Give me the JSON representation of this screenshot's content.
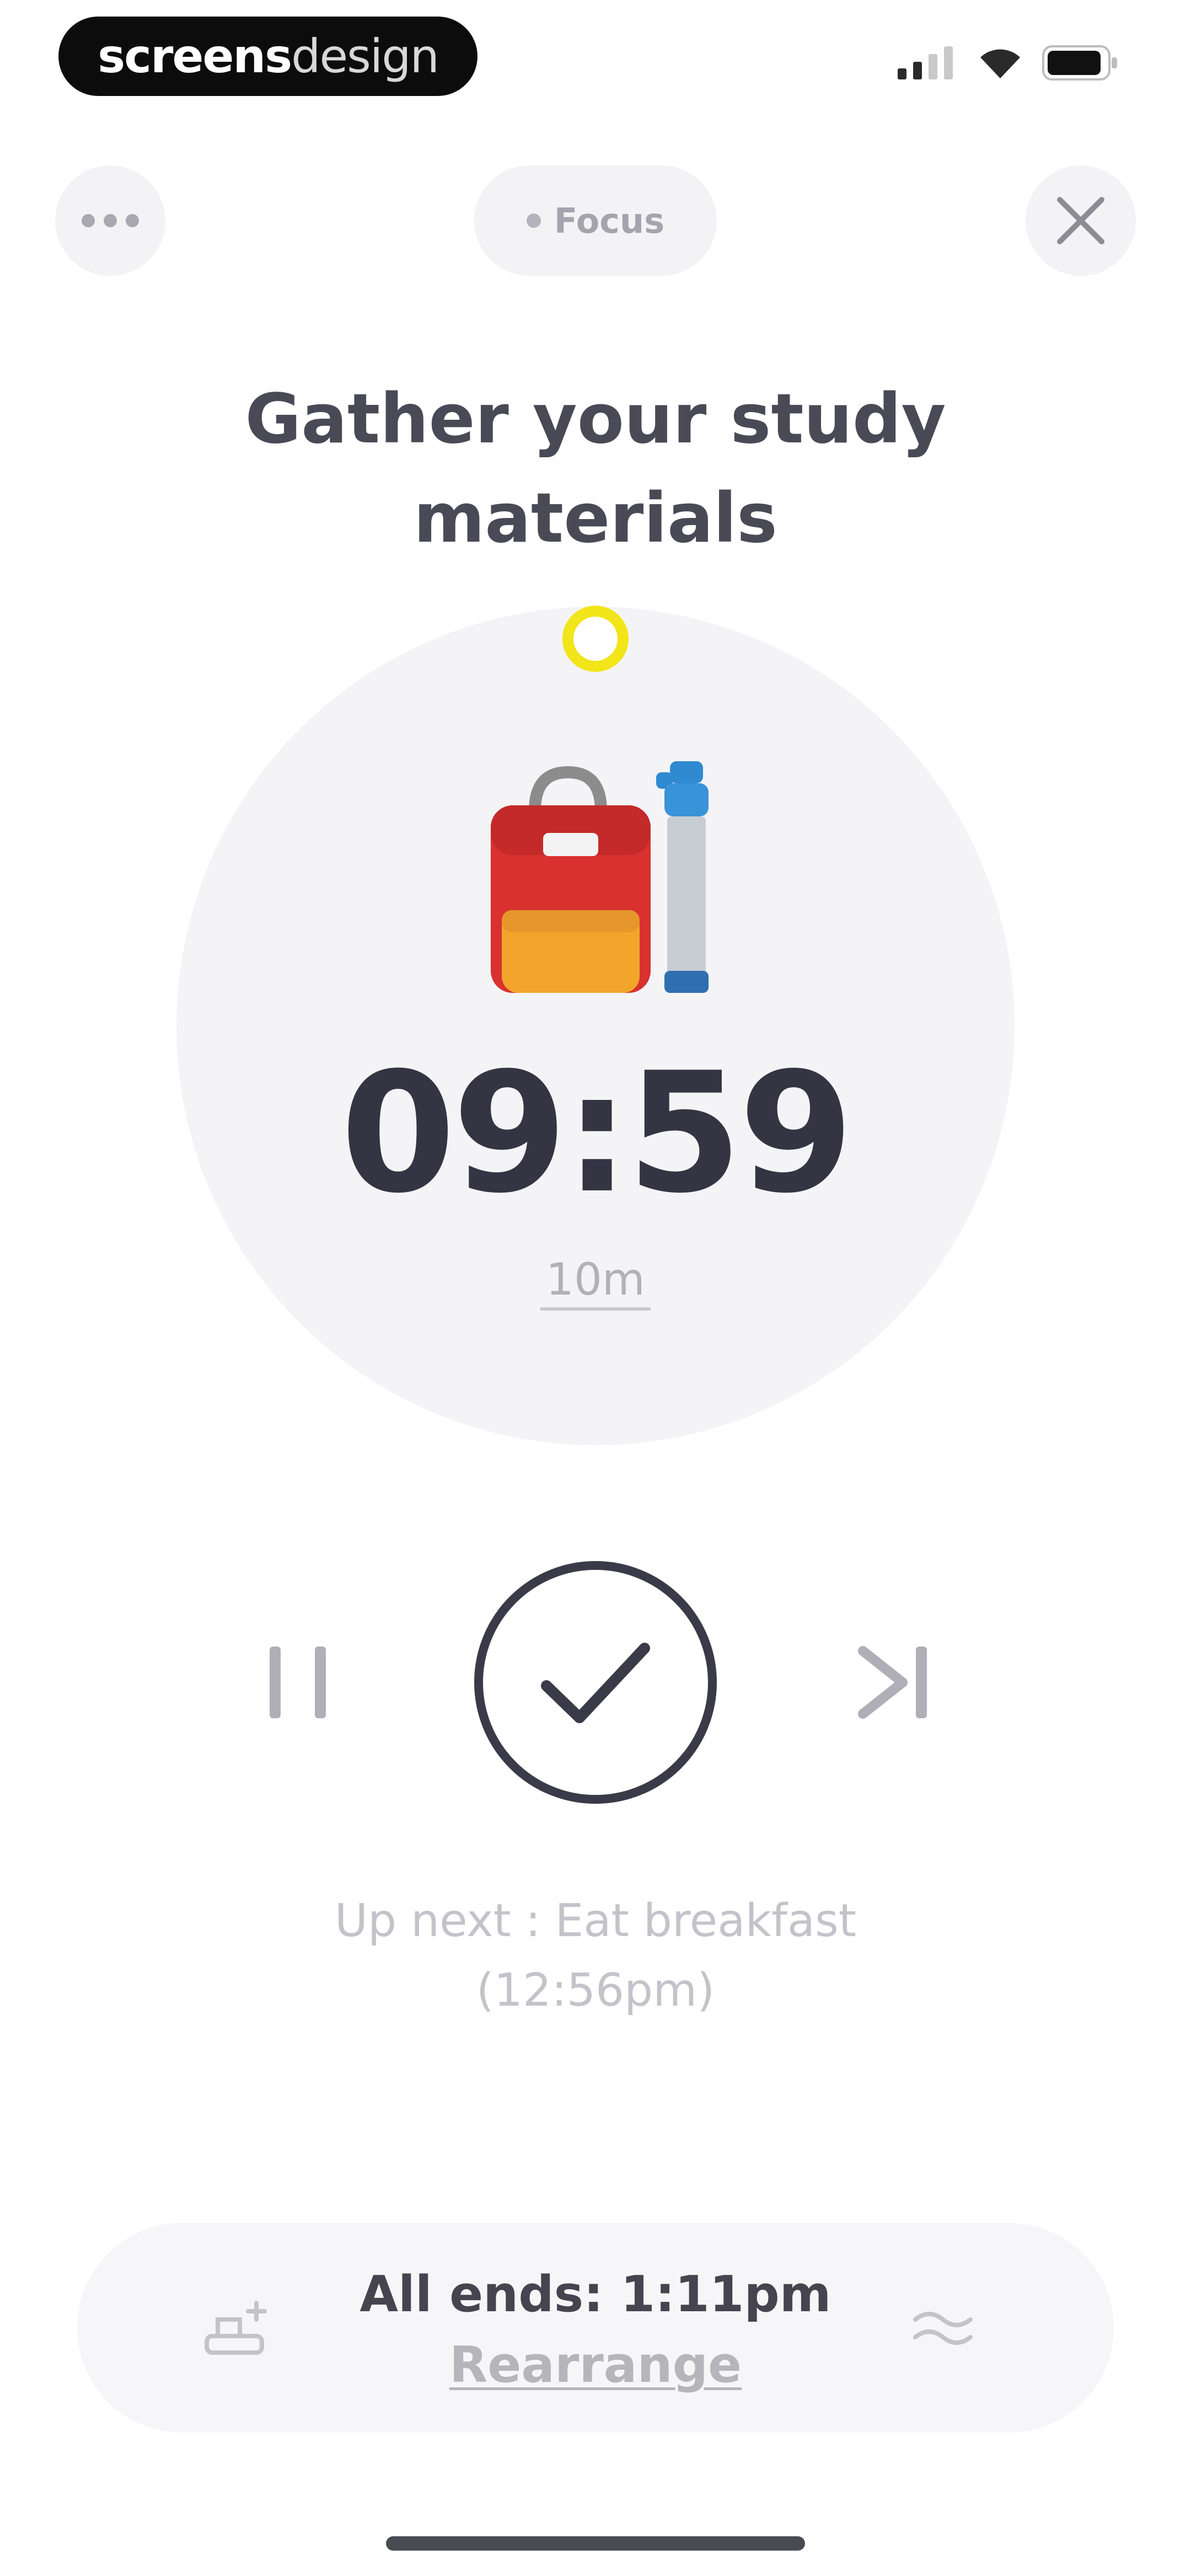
{
  "status_bar": {
    "brand_bold": "screens",
    "brand_light": "design",
    "icons": [
      "signal-icon",
      "wifi-icon",
      "battery-icon"
    ]
  },
  "header": {
    "menu_icon": "more-dots-icon",
    "focus_label": "Focus",
    "close_icon": "close-icon"
  },
  "task": {
    "title": "Gather your study materials",
    "icon": "backpack-and-bottle-icon",
    "timer": "09:59",
    "duration": "10m",
    "progress_color": "#f2e51a"
  },
  "controls": {
    "pause_icon": "pause-icon",
    "complete_icon": "check-icon",
    "skip_icon": "skip-next-icon"
  },
  "up_next": {
    "line1": "Up next : Eat breakfast",
    "line2": "(12:56pm)"
  },
  "footer": {
    "ends_text": "All ends: 1:11pm",
    "rearrange_label": "Rearrange",
    "left_icon": "add-task-icon",
    "right_icon": "reorder-icon"
  }
}
